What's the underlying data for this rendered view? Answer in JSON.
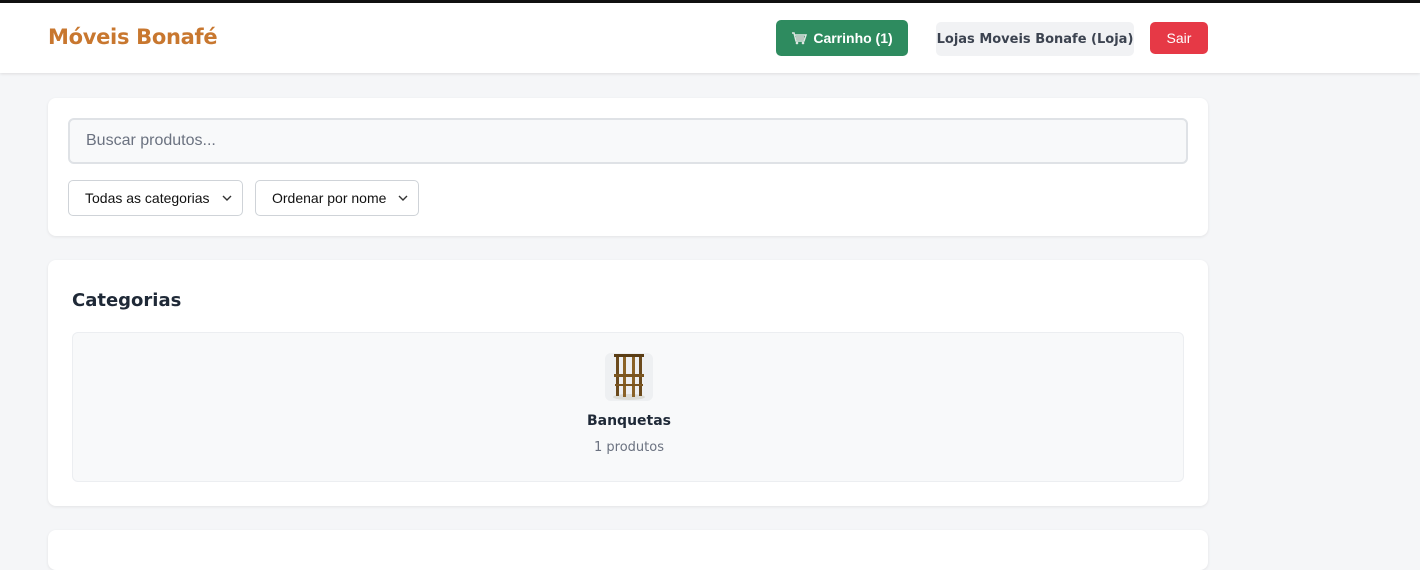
{
  "header": {
    "brand": "Móveis Bonafé",
    "cart_label": "Carrinho (1)",
    "cart_icon": "shopping-cart-icon",
    "store_label": "Lojas Moveis Bonafe (Loja)",
    "logout_label": "Sair"
  },
  "search": {
    "placeholder": "Buscar produtos...",
    "category_selected": "Todas as categorias",
    "sort_selected": "Ordenar por nome"
  },
  "categories": {
    "title": "Categorias",
    "items": [
      {
        "name": "Banquetas",
        "count": "1 produtos",
        "icon": "bar-stool-image"
      }
    ]
  },
  "colors": {
    "brand": "#c8772f",
    "cart_button": "#2e8b5f",
    "logout_button": "#e63946"
  }
}
